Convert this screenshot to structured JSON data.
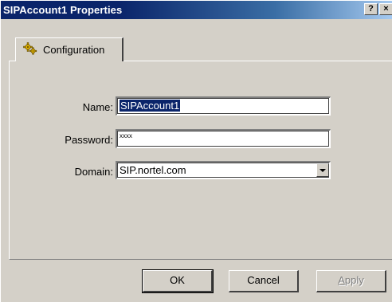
{
  "window": {
    "title": "SIPAccount1 Properties",
    "help_label": "?",
    "close_label": "×"
  },
  "tabs": [
    {
      "label": "Configuration",
      "icon": "gear-icon",
      "active": true
    }
  ],
  "form": {
    "name_label": "Name:",
    "name_value": "SIPAccount1",
    "password_label": "Password:",
    "password_value": "xxxx",
    "domain_label": "Domain:",
    "domain_value": "SIP.nortel.com"
  },
  "buttons": {
    "ok_label": "OK",
    "cancel_label": "Cancel",
    "apply_label_first": "A",
    "apply_label_rest": "pply"
  },
  "colors": {
    "titlebar_active": "#0a246a",
    "face": "#d4d0c8",
    "selection": "#0a246a"
  }
}
